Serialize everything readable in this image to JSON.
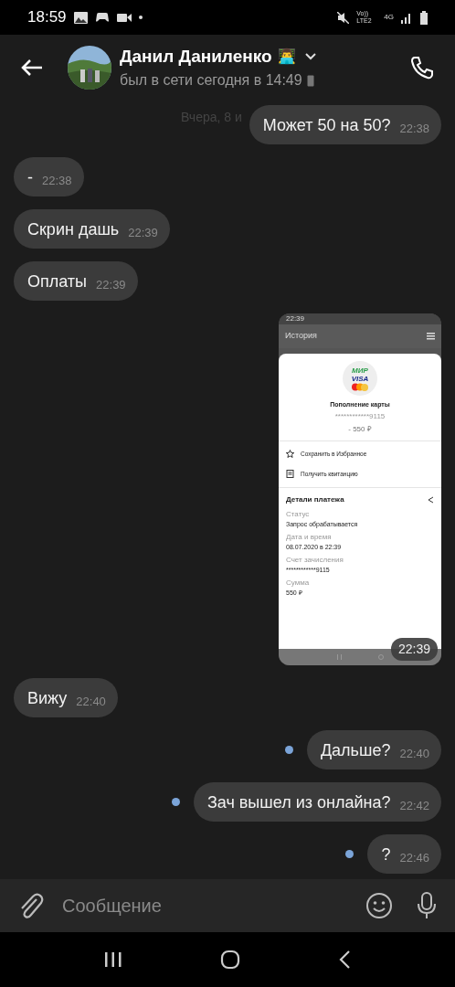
{
  "status_bar": {
    "time": "18:59",
    "network": "4G",
    "sim": "Vo)) LTE2"
  },
  "header": {
    "name": "Данил Даниленко",
    "emoji": "👨‍💻",
    "status": "был в сети сегодня в 14:49"
  },
  "date_chip": "Вчера, 8 и",
  "messages": [
    {
      "kind": "text",
      "outgoing": true,
      "unread": false,
      "text": "Может 50 на 50?",
      "time": "22:38"
    },
    {
      "kind": "text",
      "outgoing": false,
      "text": "-",
      "time": "22:38"
    },
    {
      "kind": "text",
      "outgoing": false,
      "text": "Скрин дашь",
      "time": "22:39"
    },
    {
      "kind": "text",
      "outgoing": false,
      "text": "Оплаты",
      "time": "22:39"
    },
    {
      "kind": "image",
      "time": "22:39",
      "shot": {
        "time": "22:39",
        "title": "История",
        "logos": [
          "МИР",
          "VISA"
        ],
        "operation": "Пополнение карты",
        "card": "************9115",
        "amount": "- 550 ₽",
        "actions": [
          "Сохранить в Избранное",
          "Получить квитанцию"
        ],
        "details_title": "Детали платежа",
        "fields": [
          {
            "label": "Статус",
            "value": "Запрос обрабатывается"
          },
          {
            "label": "Дата и время",
            "value": "08.07.2020 в 22:39"
          },
          {
            "label": "Счет зачисления",
            "value": "************9115"
          },
          {
            "label": "Сумма",
            "value": "550 ₽"
          }
        ]
      }
    },
    {
      "kind": "text",
      "outgoing": false,
      "text": "Вижу",
      "time": "22:40"
    },
    {
      "kind": "text",
      "outgoing": true,
      "unread": true,
      "text": "Дальше?",
      "time": "22:40"
    },
    {
      "kind": "text",
      "outgoing": true,
      "unread": true,
      "text": "Зач вышел из онлайна?",
      "time": "22:42"
    },
    {
      "kind": "text",
      "outgoing": true,
      "unread": true,
      "text": "?",
      "time": "22:46"
    }
  ],
  "composer": {
    "placeholder": "Сообщение"
  }
}
